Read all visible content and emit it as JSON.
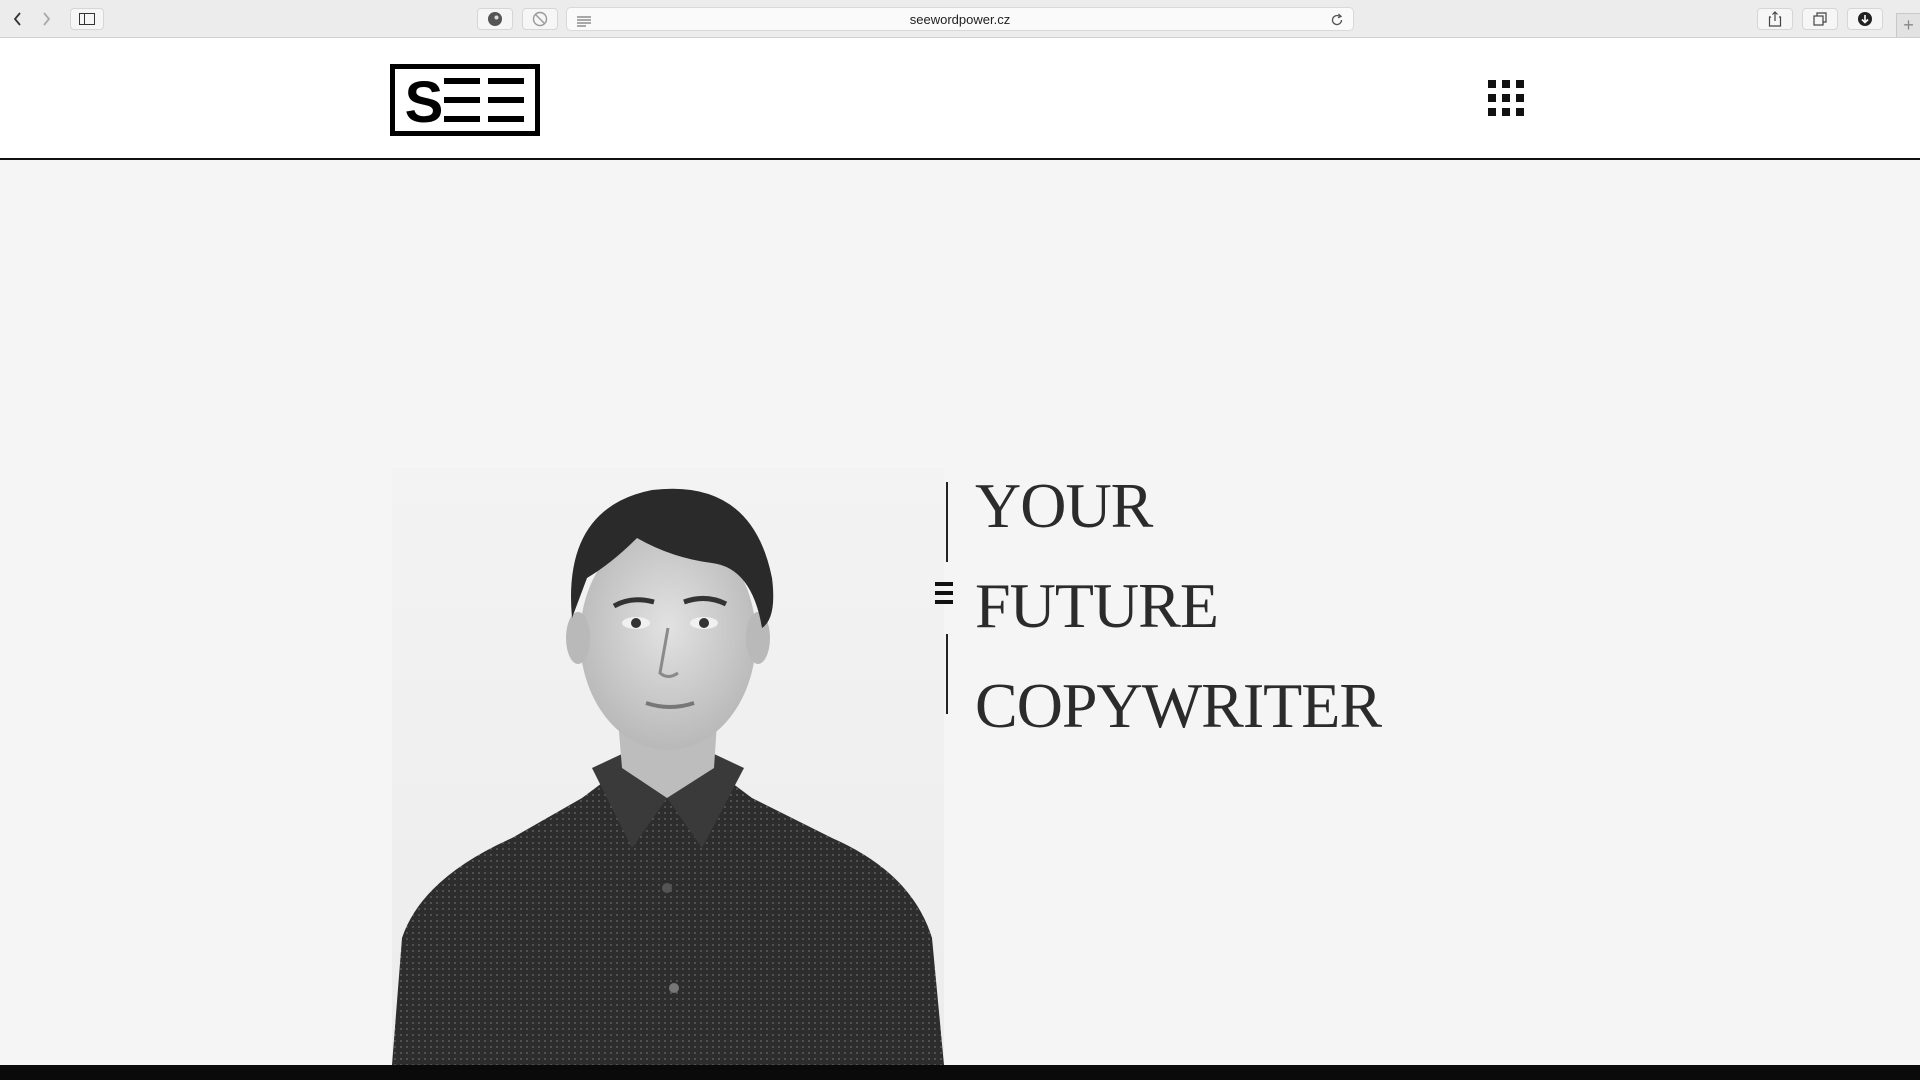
{
  "browser": {
    "url": "seewordpower.cz",
    "buttons": [
      "back",
      "forward",
      "sidebar",
      "privacy",
      "block",
      "share",
      "tabs",
      "downloads",
      "new-tab"
    ]
  },
  "site": {
    "logo_text": "SEE",
    "menu_icon": "grid-menu-icon"
  },
  "hero": {
    "lines": [
      "YOUR",
      "FUTURE",
      "COPYWRITER"
    ],
    "colors": {
      "text": "#2b2b2b",
      "background": "#f5f5f5",
      "header_border": "#111111"
    }
  }
}
